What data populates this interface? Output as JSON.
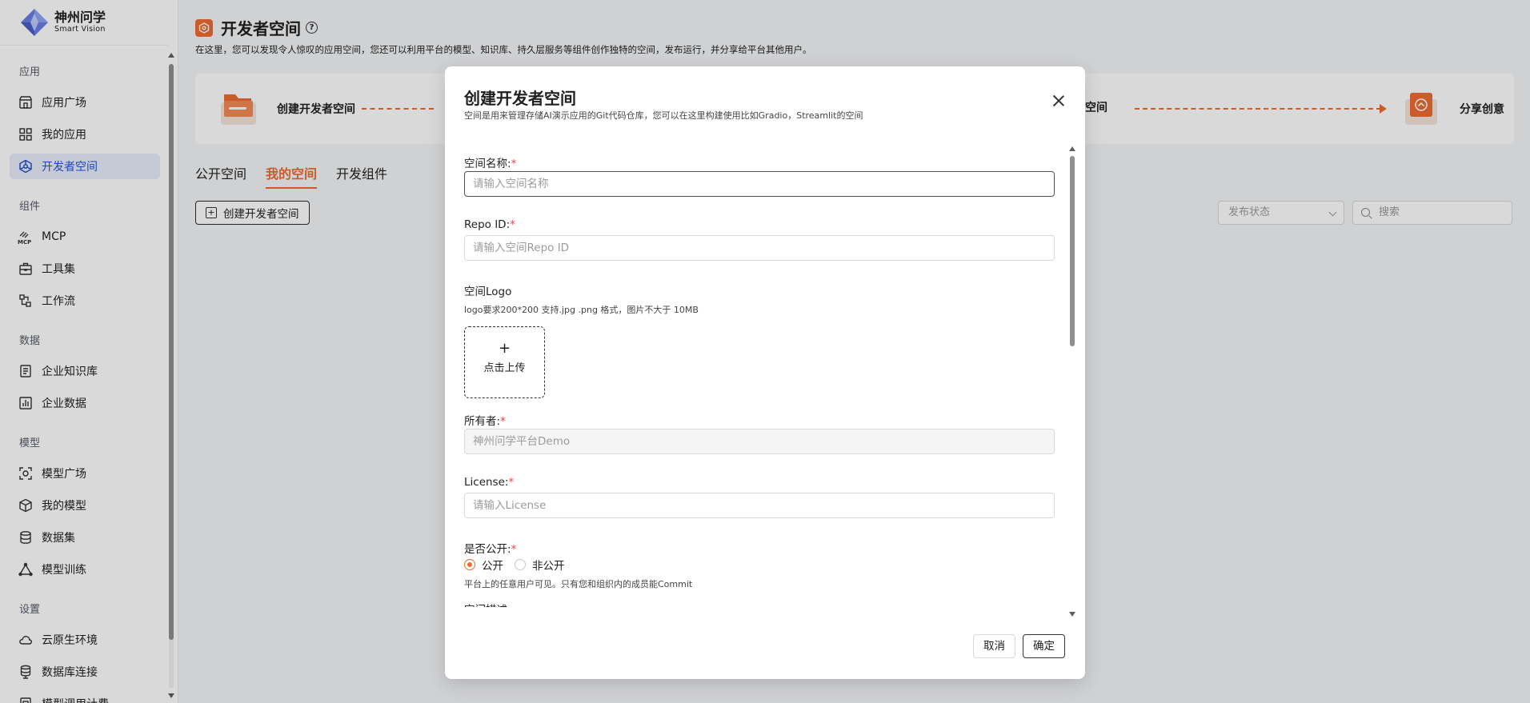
{
  "brand": {
    "title": "神州问学",
    "subtitle": "Smart Vision"
  },
  "sidebar": {
    "groups": [
      {
        "label": "应用",
        "items": [
          {
            "label": "应用广场",
            "icon": "store-icon"
          },
          {
            "label": "我的应用",
            "icon": "grid-icon"
          },
          {
            "label": "开发者空间",
            "icon": "cube-network-icon",
            "active": true
          }
        ]
      },
      {
        "label": "组件",
        "items": [
          {
            "label": "MCP",
            "icon": "mcp-icon"
          },
          {
            "label": "工具集",
            "icon": "toolbox-icon"
          },
          {
            "label": "工作流",
            "icon": "workflow-icon"
          }
        ]
      },
      {
        "label": "数据",
        "items": [
          {
            "label": "企业知识库",
            "icon": "document-icon"
          },
          {
            "label": "企业数据",
            "icon": "bar-chart-icon"
          }
        ]
      },
      {
        "label": "模型",
        "items": [
          {
            "label": "模型广场",
            "icon": "model-scan-icon"
          },
          {
            "label": "我的模型",
            "icon": "cube-icon"
          },
          {
            "label": "数据集",
            "icon": "database-icon"
          },
          {
            "label": "模型训练",
            "icon": "training-icon"
          }
        ]
      },
      {
        "label": "设置",
        "items": [
          {
            "label": "云原生环境",
            "icon": "cloud-icon"
          },
          {
            "label": "数据库连接",
            "icon": "db-link-icon"
          },
          {
            "label": "模型调用计费",
            "icon": "billing-icon"
          }
        ]
      }
    ]
  },
  "page": {
    "title": "开发者空间",
    "description": "在这里，您可以发现令人惊叹的应用空间，您还可以利用平台的模型、知识库、持久层服务等组件创作独特的空间，发布运行，并分享给平台其他用户。",
    "flow": {
      "step1": "创建开发者空间",
      "step_partial": "空间",
      "step_last": "分享创意"
    },
    "tabs": [
      {
        "label": "公开空间",
        "active": false
      },
      {
        "label": "我的空间",
        "active": true
      },
      {
        "label": "开发组件",
        "active": false
      }
    ],
    "create_button": "创建开发者空间",
    "status_select": "发布状态",
    "search_placeholder": "搜索"
  },
  "modal": {
    "title": "创建开发者空间",
    "subtitle": "空间是用来管理存储AI演示应用的Git代码仓库，您可以在这里构建使用比如Gradio，Streamlit的空间",
    "fields": {
      "name": {
        "label": "空间名称:",
        "placeholder": "请输入空间名称"
      },
      "repo": {
        "label": "Repo ID:",
        "placeholder": "请输入空间Repo ID"
      },
      "logo": {
        "label": "空间Logo",
        "hint": "logo要求200*200 支持.jpg .png 格式，图片不大于 10MB",
        "upload_plus": "+",
        "upload_text": "点击上传"
      },
      "owner": {
        "label": "所有者:",
        "value": "神州问学平台Demo"
      },
      "license": {
        "label": "License:",
        "placeholder": "请输入License"
      },
      "public": {
        "label": "是否公开:",
        "option_public": "公开",
        "option_private": "非公开",
        "selected": "公开",
        "hint": "平台上的任意用户可见。只有您和组织内的成员能Commit"
      },
      "desc": {
        "label": "空间描述:"
      }
    },
    "cancel": "取消",
    "confirm": "确定"
  },
  "colors": {
    "accent": "#ee6b32",
    "active_nav": "#2454d6",
    "required": "#e5484d"
  }
}
